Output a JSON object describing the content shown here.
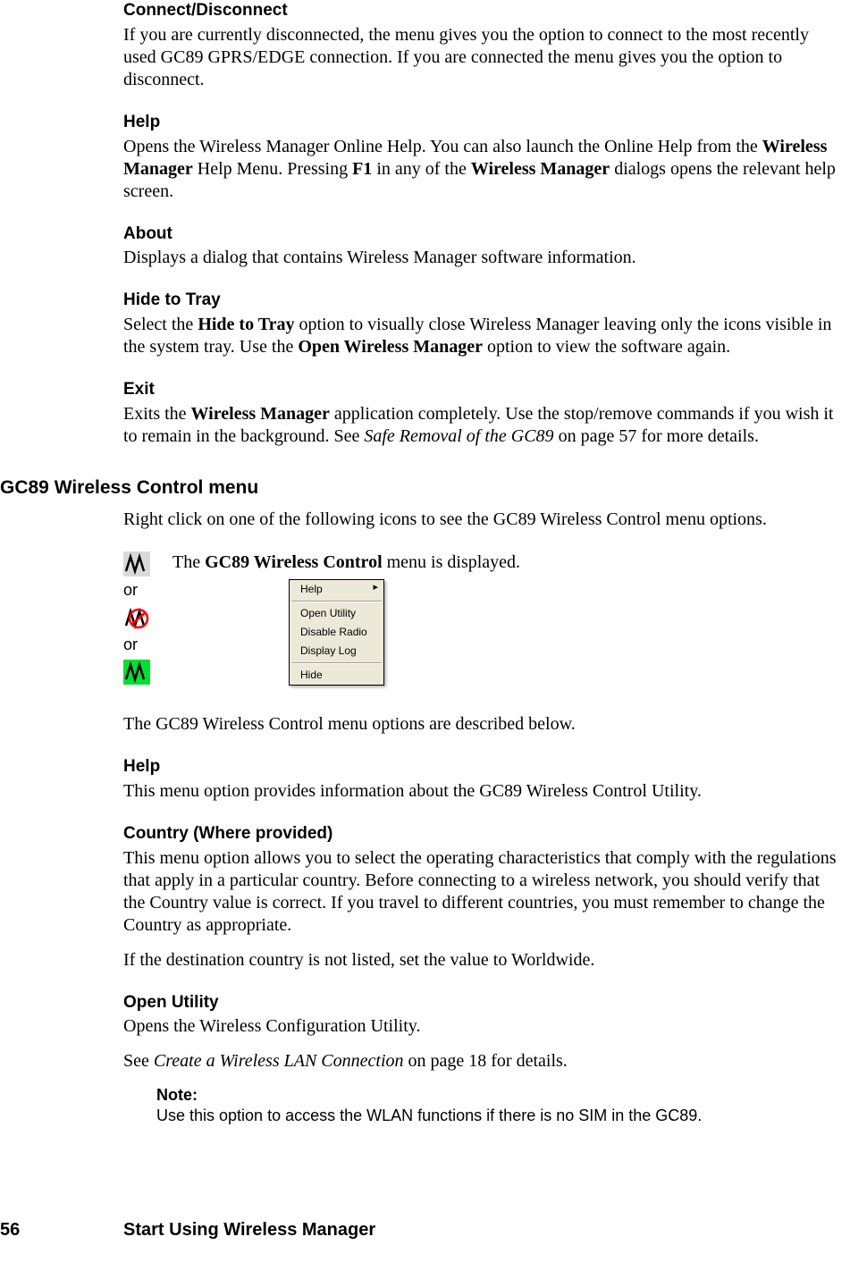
{
  "s1": {
    "h": "Connect/Disconnect",
    "p": "If you are currently disconnected, the menu gives you the option to connect to the most recently used GC89 GPRS/EDGE connection. If you are connected the menu gives you the option to disconnect."
  },
  "s2": {
    "h": "Help",
    "t1": "Opens the Wireless Manager Online Help. You can also launch the Online Help from the ",
    "b1": "Wireless Manager",
    "t2": " Help Menu. Pressing ",
    "b2": "F1",
    "t3": " in any of the ",
    "b3": "Wireless Manager",
    "t4": " dialogs opens the relevant help screen."
  },
  "s3": {
    "h": "About",
    "p": "Displays a dialog that contains Wireless Manager software information."
  },
  "s4": {
    "h": "Hide to Tray",
    "t1": "Select the ",
    "b1": "Hide to Tray",
    "t2": " option to visually close Wireless Manager leaving only the icons visible in the system tray. Use the ",
    "b2": "Open Wireless Manager",
    "t3": " option to view the software again."
  },
  "s5": {
    "h": "Exit",
    "t1": "Exits the ",
    "b1": "Wireless Manager",
    "t2": " application completely. Use the stop/remove commands if you wish it to remain in the background. See ",
    "i1": "Safe Removal of the GC89",
    "t3": " on page 57 for more details."
  },
  "sec2": {
    "title": "GC89 Wireless Control menu",
    "intro": "Right click on one of the following icons to see the GC89 Wireless Control menu options.",
    "or": "or",
    "dispt1": "The ",
    "dispb": "GC89 Wireless Control",
    "dispt2": " menu is displayed.",
    "after": "The GC89 Wireless Control menu options are described below."
  },
  "ctx": {
    "help": "Help",
    "open": "Open Utility",
    "disable": "Disable Radio",
    "log": "Display Log",
    "hide": "Hide"
  },
  "s6": {
    "h": "Help",
    "p": "This menu option provides information about the GC89 Wireless Control Utility."
  },
  "s7": {
    "h": "Country (Where provided)",
    "p1": "This menu option allows you to select the operating characteristics that comply with the regulations that apply in a particular country. Before connecting to a wireless network, you should verify that the Country value is correct. If you travel to different countries, you must remember to change the Country as appropriate.",
    "p2": "If the destination country is not listed, set the value to Worldwide."
  },
  "s8": {
    "h": "Open Utility",
    "p1": "Opens the Wireless Configuration Utility.",
    "t1": "See ",
    "i1": "Create a Wireless LAN Connection",
    "t2": " on page 18 for details."
  },
  "note": {
    "label": "Note:",
    "body": "Use this option to access the WLAN functions if there is no SIM in the GC89."
  },
  "footer": {
    "page": "56",
    "chapter": "Start Using Wireless Manager"
  }
}
